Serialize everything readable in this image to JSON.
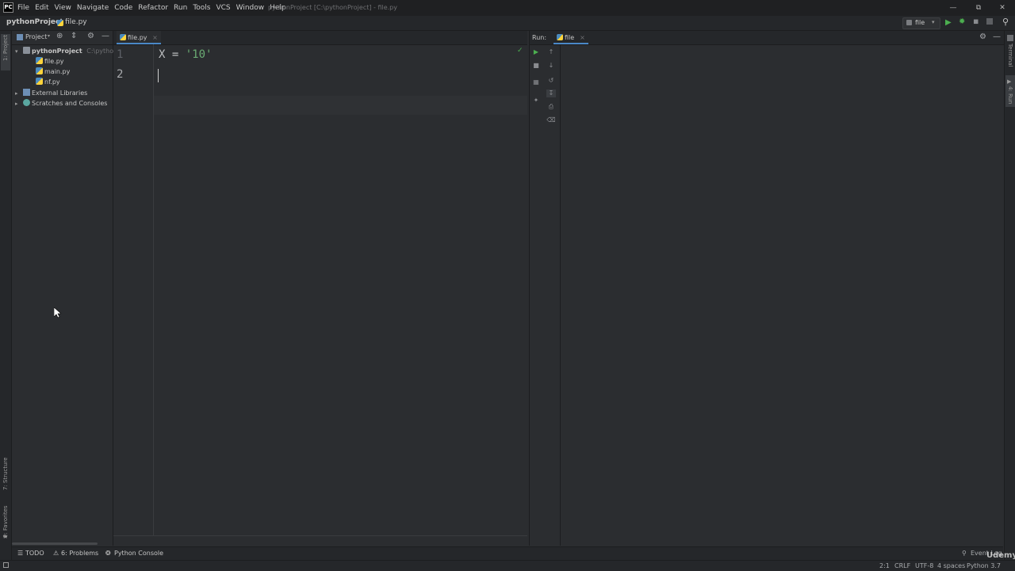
{
  "titlebar": {
    "window_title": "pythonProject [C:\\pythonProject] - file.py",
    "menu": [
      "File",
      "Edit",
      "View",
      "Navigate",
      "Code",
      "Refactor",
      "Run",
      "Tools",
      "VCS",
      "Window",
      "Help"
    ]
  },
  "navbar": {
    "project": "pythonProject",
    "file": "file.py",
    "run_config": "file"
  },
  "left_strip": {
    "project_tab": "1: Project",
    "structure_tab": "7: Structure",
    "favorites_tab": "2: Favorites"
  },
  "project_panel": {
    "title": "Project",
    "root": "pythonProject",
    "root_path": "C:\\pythonPr",
    "files": [
      "file.py",
      "main.py",
      "nf.py"
    ],
    "external_libraries": "External Libraries",
    "scratches": "Scratches and Consoles"
  },
  "editor": {
    "tab": "file.py",
    "lines": [
      "1",
      "2"
    ],
    "code_var": "X = ",
    "code_str": "'10'"
  },
  "run_panel": {
    "label": "Run:",
    "tab": "file"
  },
  "right_strip": {
    "terminal": "Terminal",
    "run": "4: Run"
  },
  "bottombar": {
    "todo": "TODO",
    "problems": "6: Problems",
    "python_console": "Python Console",
    "event_log": "Event Log"
  },
  "statusbar": {
    "position": "2:1",
    "line_sep": "CRLF",
    "encoding": "UTF-8",
    "indent": "4 spaces",
    "interpreter": "Python 3.7",
    "watermark": "Udemy"
  },
  "colors": {
    "accent": "#4a88c7",
    "string": "#6aab73",
    "run_green": "#4caf50"
  }
}
